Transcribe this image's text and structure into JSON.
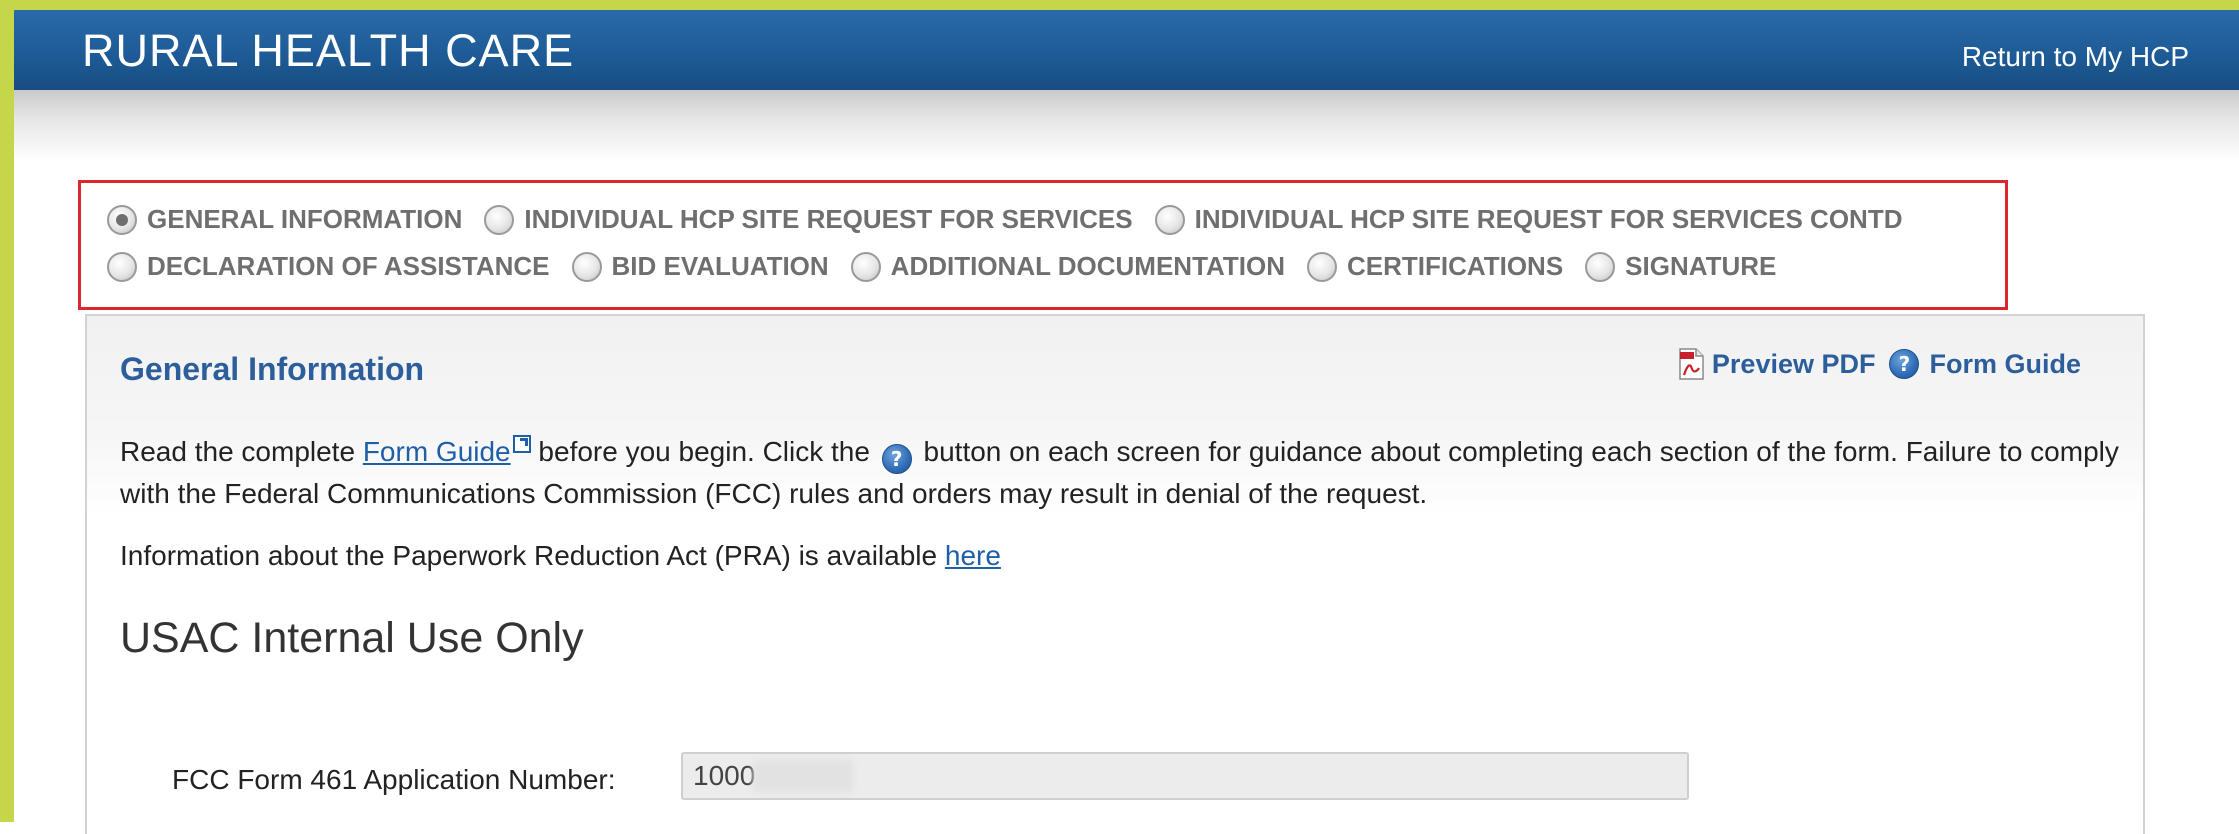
{
  "header": {
    "title": "RURAL HEALTH CARE",
    "return_link": "Return to My HCP"
  },
  "steps": {
    "row1": [
      {
        "label": "GENERAL INFORMATION",
        "checked": true
      },
      {
        "label": "INDIVIDUAL HCP SITE REQUEST FOR SERVICES",
        "checked": false
      },
      {
        "label": "INDIVIDUAL HCP SITE REQUEST FOR SERVICES CONTD",
        "checked": false
      }
    ],
    "row2": [
      {
        "label": "DECLARATION OF ASSISTANCE",
        "checked": false
      },
      {
        "label": "BID EVALUATION",
        "checked": false
      },
      {
        "label": "ADDITIONAL DOCUMENTATION",
        "checked": false
      },
      {
        "label": "CERTIFICATIONS",
        "checked": false
      },
      {
        "label": "SIGNATURE",
        "checked": false
      }
    ]
  },
  "panel": {
    "title": "General Information",
    "preview_pdf": "Preview PDF",
    "form_guide": "Form Guide",
    "intro": {
      "before_link": "Read the complete ",
      "link": "Form Guide",
      "middle": " before you begin. Click the ",
      "after": " button on each screen for guidance about completing each section of the form. Failure to comply with the Federal Communications Commission (FCC) rules and orders may result in denial of the request."
    },
    "pra": {
      "text": "Information about the Paperwork Reduction Act (PRA) is available ",
      "link": "here"
    },
    "section_heading": "USAC Internal Use Only",
    "field": {
      "label": "FCC Form 461 Application Number:",
      "value": "1000"
    }
  },
  "colors": {
    "header_blue": "#1d5a95",
    "frame_green": "#c6d64a",
    "highlight_red": "#d9262f",
    "title_blue": "#2c5e9c",
    "link_blue": "#1f5fa8"
  },
  "icons": {
    "pdf": "pdf-icon",
    "help": "help-icon",
    "external": "external-link-icon"
  }
}
